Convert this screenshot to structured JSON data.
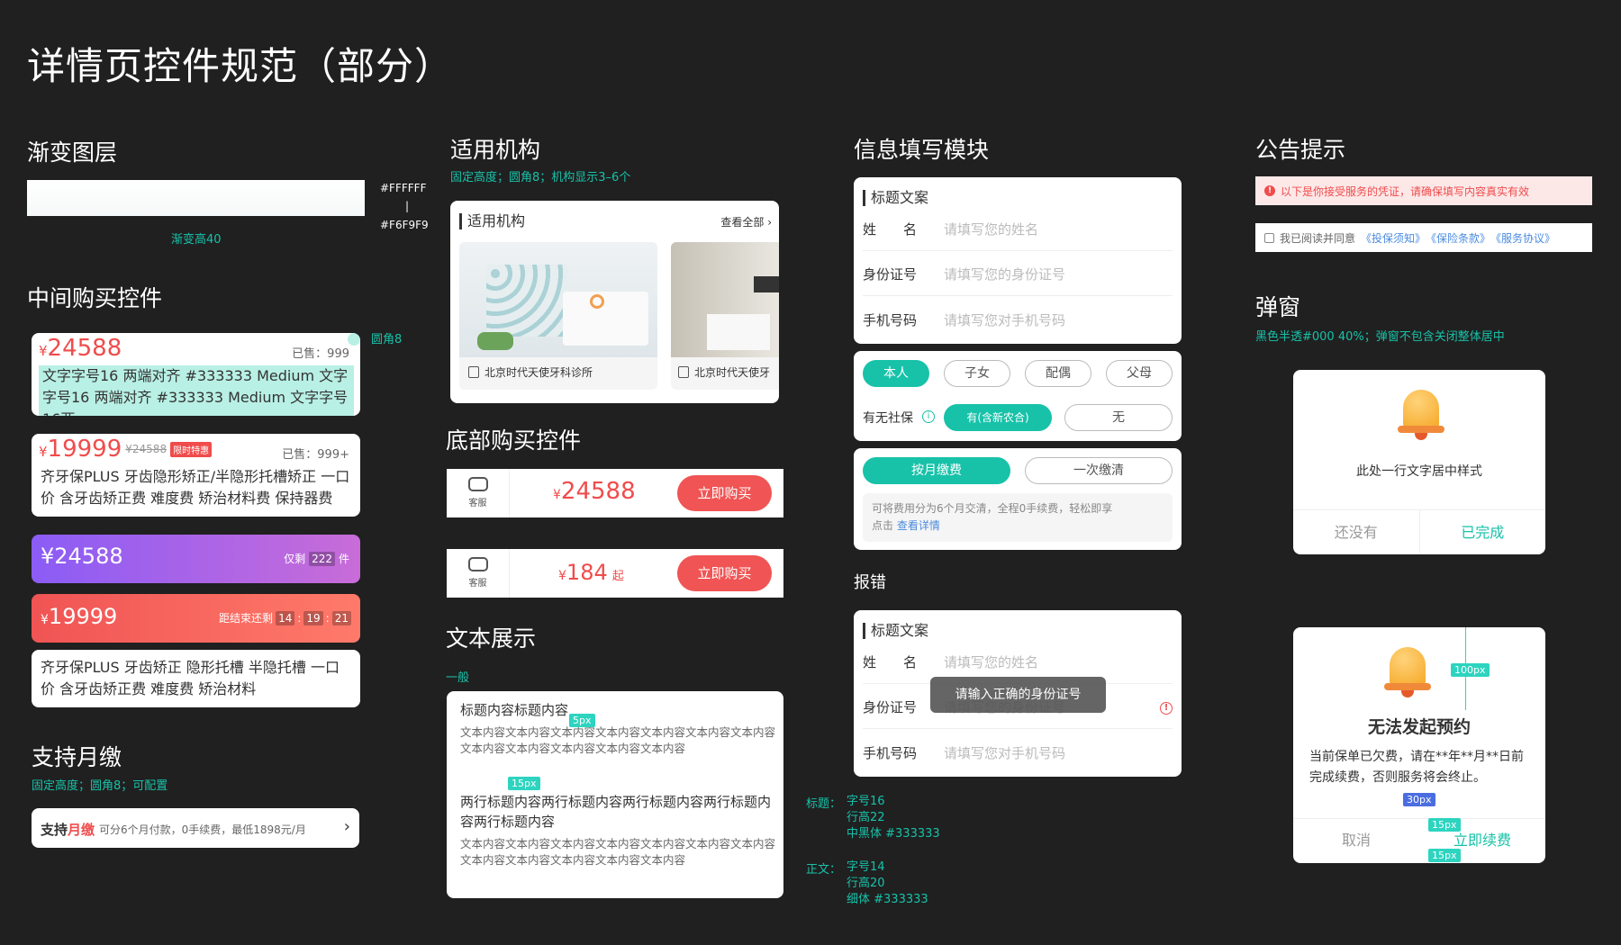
{
  "page_title": "详情页控件规范（部分）",
  "gradient": {
    "title": "渐变图层",
    "color_top": "#FFFFFF",
    "divider": "|",
    "color_bottom": "#F6F9F9",
    "caption": "渐变高40"
  },
  "mid_purchase": {
    "title": "中间购买控件",
    "radius_note": "圆角8",
    "card1": {
      "yen": "¥",
      "price": "24588",
      "sold": "已售：999",
      "text": "文字字号16 两端对齐 #333333 Medium 文字字号16 两端对齐 #333333 Medium 文字字号16两"
    },
    "card2": {
      "yen": "¥",
      "price": "19999",
      "old_price": "¥24588",
      "tag": "限时特惠",
      "sold": "已售：999+",
      "text": "齐牙保PLUS 牙齿隐形矫正/半隐形托槽矫正 一口价 含牙齿矫正费 难度费 矫治材料费 保持器费"
    },
    "card3": {
      "price": "¥24588",
      "left_pre": "仅剩",
      "left_num": "222",
      "left_post": "件"
    },
    "card4": {
      "yen": "¥",
      "price": "19999",
      "countdown_label": "距结束还剩",
      "h": "14",
      "m": "19",
      "s": "21",
      "sep": ":"
    },
    "card5": {
      "text": "齐牙保PLUS 牙齿矫正 隐形托槽 半隐托槽 一口价 含牙齿矫正费 难度费 矫治材料"
    }
  },
  "monthly": {
    "title": "支持月缴",
    "note": "固定高度；圆角8；可配置",
    "logo_a": "支持",
    "logo_b": "月缴",
    "text": "可分6个月付款，0手续费，最低1898元/月",
    "arrow": "›"
  },
  "institutions": {
    "title": "适用机构",
    "note": "固定高度；圆角8；机构显示3–6个",
    "card_title": "适用机构",
    "view_all": "查看全部 ›",
    "items": [
      "北京时代天使牙科诊所",
      "北京时代天使牙"
    ]
  },
  "bottom_purchase": {
    "title": "底部购买控件",
    "service": "客服",
    "bar1": {
      "yen": "¥",
      "price": "24588",
      "button": "立即购买"
    },
    "bar2": {
      "yen": "¥",
      "price": "184",
      "suffix": "起",
      "button": "立即购买"
    }
  },
  "text_display": {
    "title": "文本展示",
    "note": "一般",
    "heading1": "标题内容标题内容",
    "body1": "文本内容文本内容文本内容文本内容文本内容文本内容文本内容文本内容文本内容文本内容文本内容文本内容",
    "heading2": "两行标题内容两行标题内容两行标题内容两行标题内容两行标题内容",
    "body2": "文本内容文本内容文本内容文本内容文本内容文本内容文本内容文本内容文本内容文本内容文本内容文本内容",
    "m1": "5px",
    "m2": "15px",
    "spec_title_label": "标题：",
    "spec_title_1": "字号16",
    "spec_title_2": "行高22",
    "spec_title_3": "中黑体 #333333",
    "spec_body_label": "正文：",
    "spec_body_1": "字号14",
    "spec_body_2": "行高20",
    "spec_body_3": "细体 #333333"
  },
  "info_form": {
    "title": "信息填写模块",
    "form_title": "标题文案",
    "rows": [
      {
        "label": "姓　　名",
        "placeholder": "请填写您的姓名"
      },
      {
        "label": "身份证号",
        "placeholder": "请填写您的身份证号"
      },
      {
        "label": "手机号码",
        "placeholder": "请填写您对手机号码"
      }
    ],
    "relations": [
      "本人",
      "子女",
      "配偶",
      "父母"
    ],
    "social_label": "有无社保",
    "social_yes": "有(含新农合)",
    "social_no": "无",
    "pay_monthly": "按月缴费",
    "pay_once": "一次缴清",
    "pay_note": "可将费用分为6个月交清，全程0手续费，轻松即享",
    "pay_link_pre": "点击",
    "pay_link": "查看详情"
  },
  "error_form": {
    "title": "报错",
    "toast": "请输入正确的身份证号"
  },
  "notice": {
    "title": "公告提示",
    "warn": "以下是你接受服务的凭证，请确保填写内容真实有效",
    "agree_pre": "我已阅读并同意",
    "links": [
      "《投保须知》",
      "《保险条款》",
      "《服务协议》"
    ]
  },
  "popup": {
    "title": "弹窗",
    "note": "黑色半透#000 40%；弹窗不包含关闭整体居中",
    "d1_text": "此处一行文字居中样式",
    "d1_left": "还没有",
    "d1_right": "已完成",
    "d2_title": "无法发起预约",
    "d2_text": "当前保单已欠费，请在**年**月**日前完成续费，否则服务将会终止。",
    "d2_left": "取消",
    "d2_right": "立即续费",
    "m100": "100px",
    "m30": "30px",
    "m15a": "15px",
    "m15b": "15px"
  },
  "colors": {
    "accent": "#17c2a9",
    "price_red": "#f04c4c",
    "background": "#202020"
  }
}
